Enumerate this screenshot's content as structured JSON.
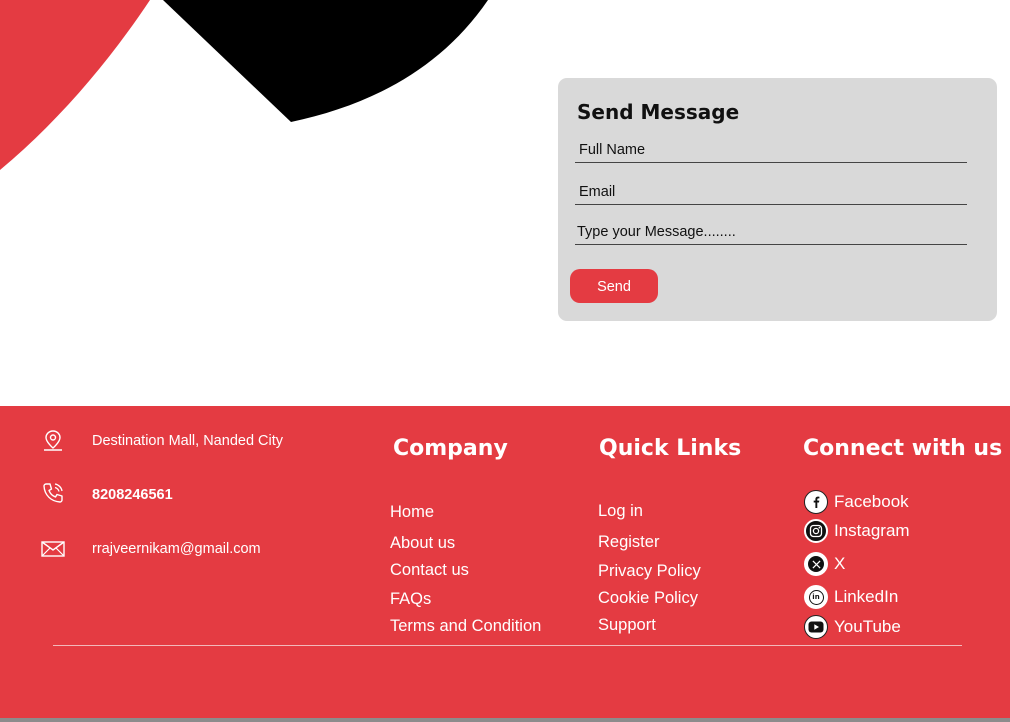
{
  "colors": {
    "brand_red": "#e43b42",
    "card_gray": "#d9d9d9",
    "black": "#000000"
  },
  "send_message": {
    "title": "Send Message",
    "name_placeholder": "Full Name",
    "email_placeholder": "Email",
    "message_placeholder": "Type your Message........",
    "send_label": "Send"
  },
  "footer": {
    "contact": {
      "address": "Destination Mall, Nanded City",
      "phone": "8208246561",
      "email": "rrajveernikam@gmail.com"
    },
    "company": {
      "title": "Company",
      "links": [
        "Home",
        "About us",
        "Contact us",
        "FAQs",
        "Terms and Condition"
      ]
    },
    "quick_links": {
      "title": "Quick Links",
      "links": [
        "Log in",
        "Register",
        "Privacy Policy",
        "Cookie Policy",
        "Support"
      ]
    },
    "connect": {
      "title": "Connect with us",
      "items": [
        {
          "label": "Facebook",
          "icon": "facebook-icon"
        },
        {
          "label": "Instagram",
          "icon": "instagram-icon"
        },
        {
          "label": "X",
          "icon": "x-icon"
        },
        {
          "label": "LinkedIn",
          "icon": "linkedin-icon"
        },
        {
          "label": "YouTube",
          "icon": "youtube-icon"
        }
      ]
    }
  }
}
